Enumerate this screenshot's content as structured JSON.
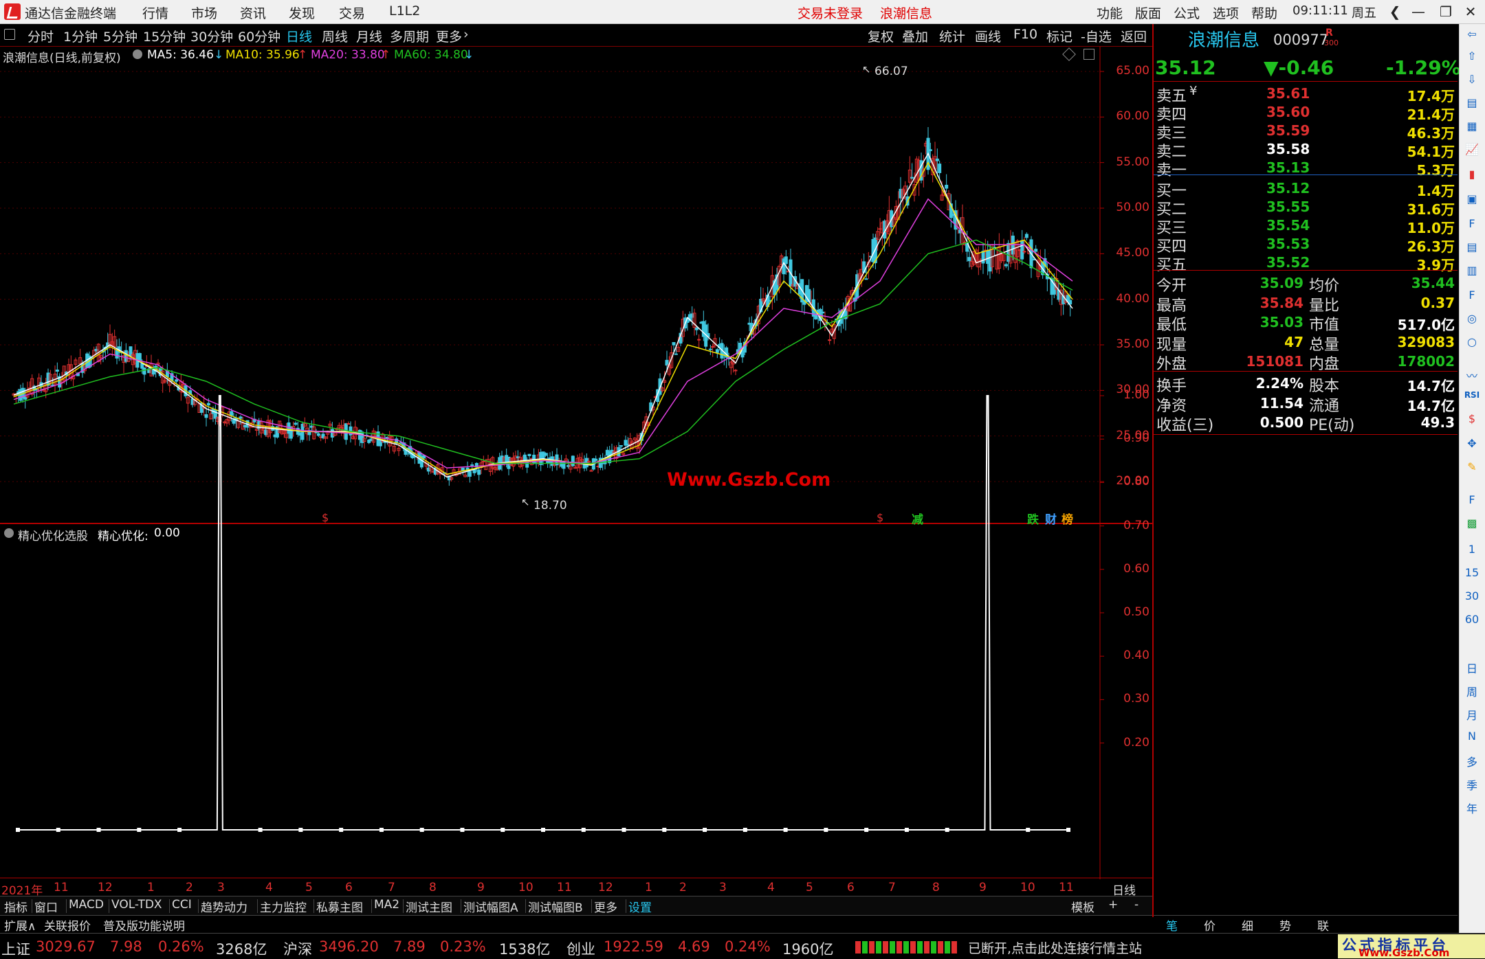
{
  "app": {
    "title": "通达信金融终端",
    "menu": [
      "行情",
      "市场",
      "资讯",
      "发现",
      "交易",
      "L1L2"
    ],
    "notice_login": "交易未登录",
    "notice_stock": "浪潮信息",
    "right_menu": [
      "功能",
      "版面",
      "公式",
      "选项",
      "帮助"
    ],
    "clock": "09:11:11",
    "weekday": "周五"
  },
  "period_tabs": [
    "分时",
    "1分钟",
    "5分钟",
    "15分钟",
    "30分钟",
    "60分钟",
    "日线",
    "周线",
    "月线",
    "多周期",
    "更多"
  ],
  "active_tab": "日线",
  "right_tools": [
    "复权",
    "叠加",
    "统计",
    "画线",
    "F10",
    "标记",
    "-自选",
    "返回"
  ],
  "main_chart": {
    "header_name": "浪潮信息(日线,前复权)",
    "ma5": "MA5: 36.46",
    "ma10": "MA10: 35.96",
    "ma20": "MA20: 33.80",
    "ma60": "MA60: 34.80",
    "high_label": "66.07",
    "low_label": "18.70",
    "watermark": "Www.Gszb.Com",
    "event_markers": [
      "$",
      "$",
      "减",
      "跌",
      "财",
      "榜"
    ],
    "colors": {
      "up": "#e03030",
      "down": "#40c8e0",
      "ma5": "#ffffff",
      "ma10": "#f0e000",
      "ma20": "#e040e0",
      "ma60": "#20c020"
    }
  },
  "chart_data": [
    {
      "type": "line",
      "title": "浪潮信息(日线,前复权)",
      "x": [
        "2021-01",
        "2021-02",
        "2021-03",
        "2021-04",
        "2021-05",
        "2021-06",
        "2021-07",
        "2021-08",
        "2021-09",
        "2021-10",
        "2021-11",
        "2021-12",
        "2022-01",
        "2022-02",
        "2022-03",
        "2022-04",
        "2022-05",
        "2022-06",
        "2022-07",
        "2022-08",
        "2022-09",
        "2022-10",
        "2022-11"
      ],
      "series": [
        {
          "name": "MA5",
          "values": [
            29.5,
            31.5,
            35.0,
            32.0,
            28.0,
            26.0,
            25.5,
            25.5,
            24.0,
            20.5,
            22.0,
            22.5,
            21.8,
            24.5,
            38.0,
            33.0,
            44.0,
            36.0,
            46.5,
            56.0,
            44.0,
            46.0,
            39.0
          ]
        },
        {
          "name": "MA10",
          "values": [
            29.3,
            31.2,
            34.8,
            32.2,
            28.3,
            26.2,
            25.5,
            25.4,
            24.2,
            20.8,
            21.9,
            22.4,
            21.9,
            24.0,
            35.0,
            33.5,
            42.0,
            37.0,
            45.0,
            55.0,
            45.0,
            46.5,
            40.0
          ]
        },
        {
          "name": "MA20",
          "values": [
            29.0,
            30.8,
            34.0,
            32.8,
            29.0,
            26.8,
            25.6,
            25.3,
            24.5,
            21.5,
            21.8,
            22.3,
            22.0,
            23.2,
            31.0,
            34.0,
            39.0,
            38.0,
            42.0,
            51.0,
            46.0,
            46.0,
            42.0
          ]
        },
        {
          "name": "MA60",
          "values": [
            28.5,
            30.0,
            31.5,
            32.5,
            31.0,
            28.5,
            26.5,
            25.5,
            25.0,
            23.5,
            22.0,
            22.0,
            22.0,
            22.5,
            25.5,
            31.0,
            34.5,
            37.5,
            39.5,
            45.0,
            46.5,
            44.0,
            41.0
          ]
        }
      ],
      "ylim": [
        18,
        66
      ],
      "y_ticks": [
        "65.00",
        "60.00",
        "55.00",
        "50.00",
        "45.00",
        "40.00",
        "35.00",
        "30.00",
        "25.00",
        "20.00"
      ]
    },
    {
      "type": "line",
      "title": "精心优化选股",
      "series": [
        {
          "name": "精心优化",
          "values": [
            0,
            0,
            0,
            0,
            0,
            1,
            0,
            0,
            0,
            0,
            0,
            0,
            0,
            0,
            0,
            0,
            0,
            0,
            0,
            0,
            0,
            0,
            0,
            0,
            1,
            0,
            0
          ]
        }
      ],
      "ylim": [
        0,
        1
      ],
      "y_ticks": [
        "1.00",
        "0.90",
        "0.80",
        "0.70",
        "0.60",
        "0.50",
        "0.40",
        "0.30",
        "0.20"
      ]
    }
  ],
  "indicator": {
    "name": "精心优化选股",
    "label": "精心优化:",
    "value": "0.00"
  },
  "x_axis": [
    "2021年",
    "11",
    "12",
    "1",
    "2",
    "3",
    "4",
    "5",
    "6",
    "7",
    "8",
    "9",
    "10",
    "11",
    "12",
    "1",
    "2",
    "3",
    "4",
    "5",
    "6",
    "7",
    "8",
    "9",
    "10",
    "11"
  ],
  "x_axis_right": "日线",
  "bottom_tabs": [
    "指标",
    "窗口",
    "MACD",
    "VOL-TDX",
    "CCI",
    "趋势动力",
    "主力监控",
    "私募主图",
    "MA2",
    "测试主图",
    "测试幅图A",
    "测试幅图B",
    "更多",
    "设置"
  ],
  "bottom_right": [
    "模板",
    "+",
    "-"
  ],
  "sub_tabs": [
    "扩展∧",
    "关联报价",
    "普及版功能说明"
  ],
  "quote": {
    "name": "浪潮信息",
    "code": "000977",
    "badge": "R",
    "badge_sub": "300",
    "price": "35.12",
    "change": "▼-0.46",
    "pct": "-1.29%",
    "asks": [
      {
        "label": "卖五",
        "price": "35.61",
        "vol": "17.4万",
        "color": "#e03030"
      },
      {
        "label": "卖四",
        "price": "35.60",
        "vol": "21.4万",
        "color": "#e03030"
      },
      {
        "label": "卖三",
        "price": "35.59",
        "vol": "46.3万",
        "color": "#e03030"
      },
      {
        "label": "卖二",
        "price": "35.58",
        "vol": "54.1万",
        "color": "#ffffff"
      },
      {
        "label": "卖一",
        "price": "35.13",
        "vol": "5.3万",
        "color": "#20c020"
      }
    ],
    "bids": [
      {
        "label": "买一",
        "price": "35.12",
        "vol": "1.4万",
        "color": "#20c020"
      },
      {
        "label": "买二",
        "price": "35.55",
        "vol": "31.6万",
        "color": "#20c020"
      },
      {
        "label": "买三",
        "price": "35.54",
        "vol": "11.0万",
        "color": "#20c020"
      },
      {
        "label": "买四",
        "price": "35.53",
        "vol": "26.3万",
        "color": "#20c020"
      },
      {
        "label": "买五",
        "price": "35.52",
        "vol": "3.9万",
        "color": "#20c020"
      }
    ],
    "stats": [
      {
        "l1": "今开",
        "v1": "35.09",
        "c1": "#20c020",
        "l2": "均价",
        "v2": "35.44",
        "c2": "#20c020"
      },
      {
        "l1": "最高",
        "v1": "35.84",
        "c1": "#e03030",
        "l2": "量比",
        "v2": "0.37",
        "c2": "#f0e000"
      },
      {
        "l1": "最低",
        "v1": "35.03",
        "c1": "#20c020",
        "l2": "市值",
        "v2": "517.0亿",
        "c2": "#ffffff"
      },
      {
        "l1": "现量",
        "v1": "47",
        "c1": "#f0e000",
        "l2": "总量",
        "v2": "329083",
        "c2": "#f0e000"
      },
      {
        "l1": "外盘",
        "v1": "151081",
        "c1": "#e03030",
        "l2": "内盘",
        "v2": "178002",
        "c2": "#20c020"
      }
    ],
    "stats2": [
      {
        "l1": "换手",
        "v1": "2.24%",
        "l2": "股本",
        "v2": "14.7亿"
      },
      {
        "l1": "净资",
        "v1": "11.54",
        "l2": "流通",
        "v2": "14.7亿"
      },
      {
        "l1": "收益(三)",
        "v1": "0.500",
        "l2": "PE(动)",
        "v2": "49.3"
      }
    ],
    "bottom_tabs": [
      "笔",
      "价",
      "细",
      "势",
      "联"
    ]
  },
  "side_strip": [
    "1",
    "15",
    "30",
    "60",
    "日",
    "周",
    "月",
    "N",
    "多",
    "季",
    "年"
  ],
  "status_bar": {
    "sh_name": "上证",
    "sh_val": "3029.67",
    "sh_chg": "7.98",
    "sh_pct": "0.26%",
    "sh_amt": "3268亿",
    "sz_name": "沪深",
    "sz_val": "3496.20",
    "sz_chg": "7.89",
    "sz_pct": "0.23%",
    "sz_amt": "1538亿",
    "cy_name": "创业",
    "cy_val": "1922.59",
    "cy_chg": "4.69",
    "cy_pct": "0.24%",
    "cy_amt": "1960亿",
    "message": "已断开,点击此处连接行情主站",
    "brand": "公式指标平台",
    "brand_url": "Www.Gszb.Com"
  }
}
